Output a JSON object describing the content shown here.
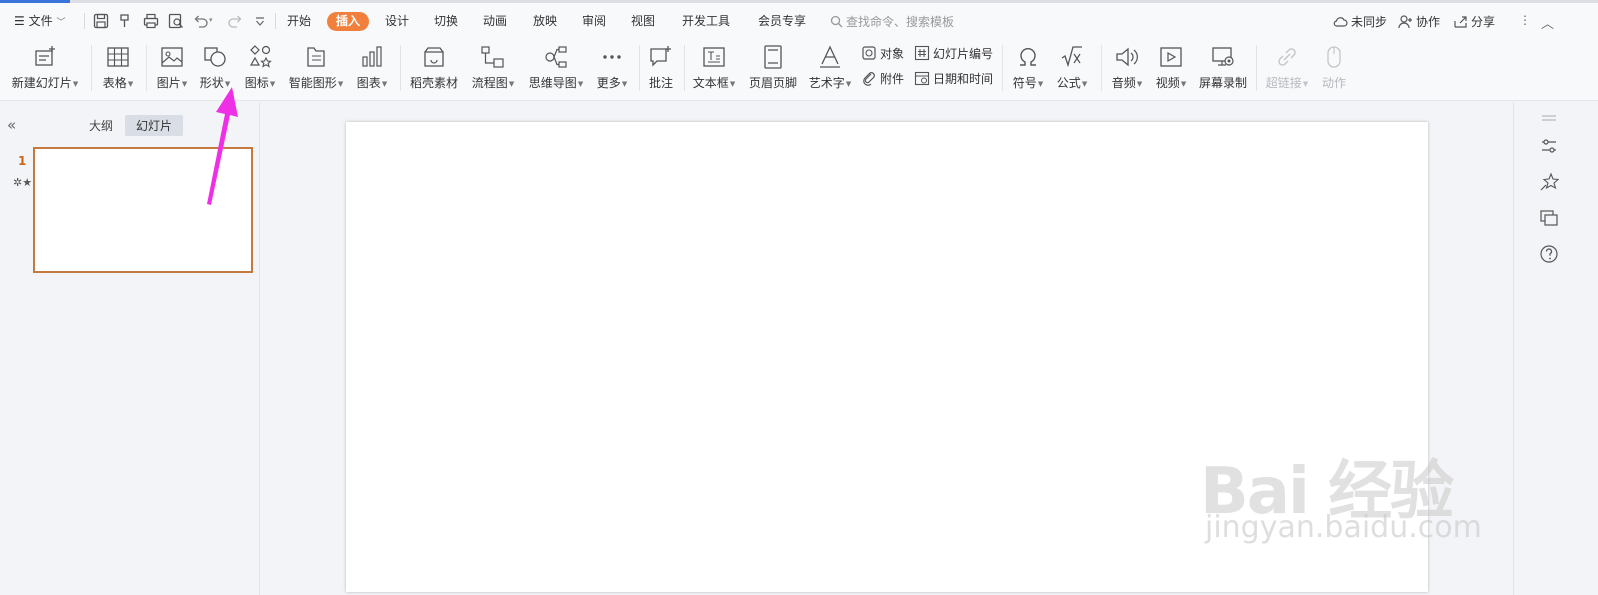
{
  "menu": {
    "file": "文件",
    "tabs": [
      "开始",
      "插入",
      "设计",
      "切换",
      "动画",
      "放映",
      "审阅",
      "视图",
      "开发工具",
      "会员专享"
    ],
    "active_tab": "插入",
    "search_placeholder": "查找命令、搜索模板",
    "right": {
      "sync": "未同步",
      "collab": "协作",
      "share": "分享"
    }
  },
  "ribbon": {
    "new_slide": "新建幻灯片",
    "table": "表格",
    "picture": "图片",
    "shape": "形状",
    "icon": "图标",
    "smartart": "智能图形",
    "chart": "图表",
    "docer": "稻壳素材",
    "flowchart": "流程图",
    "mindmap": "思维导图",
    "more": "更多",
    "comment": "批注",
    "textbox": "文本框",
    "header_footer": "页眉页脚",
    "wordart": "艺术字",
    "object": "对象",
    "slide_number": "幻灯片编号",
    "attachment": "附件",
    "datetime": "日期和时间",
    "symbol": "符号",
    "formula": "公式",
    "audio": "音频",
    "video": "视频",
    "screen_record": "屏幕录制",
    "hyperlink": "超链接",
    "action": "动作"
  },
  "left_panel": {
    "tab_outline": "大纲",
    "tab_slides": "幻灯片",
    "slide_number": "1"
  },
  "watermark": {
    "line1": "Bai 经验",
    "line2": "jingyan.baidu.com"
  },
  "colors": {
    "accent": "#f0803c",
    "arrow": "#ee2fe6",
    "selection_border": "#c47a3e"
  }
}
